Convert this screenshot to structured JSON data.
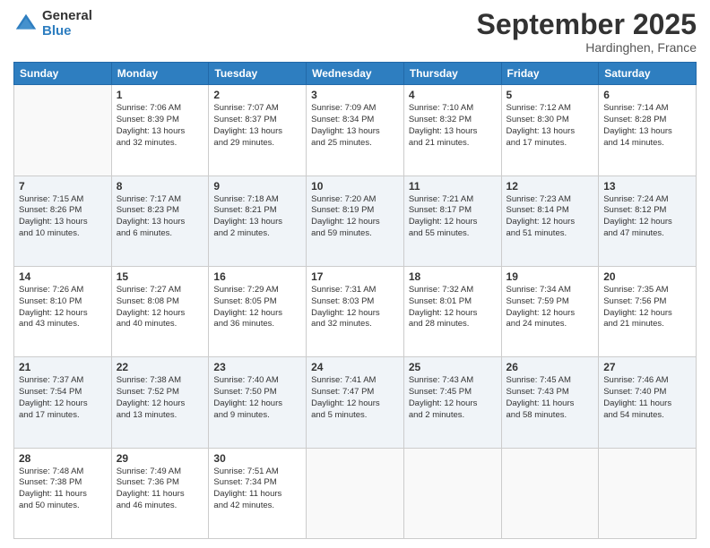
{
  "logo": {
    "general": "General",
    "blue": "Blue"
  },
  "title": "September 2025",
  "location": "Hardinghen, France",
  "days_header": [
    "Sunday",
    "Monday",
    "Tuesday",
    "Wednesday",
    "Thursday",
    "Friday",
    "Saturday"
  ],
  "weeks": [
    [
      {
        "day": "",
        "info": ""
      },
      {
        "day": "1",
        "info": "Sunrise: 7:06 AM\nSunset: 8:39 PM\nDaylight: 13 hours\nand 32 minutes."
      },
      {
        "day": "2",
        "info": "Sunrise: 7:07 AM\nSunset: 8:37 PM\nDaylight: 13 hours\nand 29 minutes."
      },
      {
        "day": "3",
        "info": "Sunrise: 7:09 AM\nSunset: 8:34 PM\nDaylight: 13 hours\nand 25 minutes."
      },
      {
        "day": "4",
        "info": "Sunrise: 7:10 AM\nSunset: 8:32 PM\nDaylight: 13 hours\nand 21 minutes."
      },
      {
        "day": "5",
        "info": "Sunrise: 7:12 AM\nSunset: 8:30 PM\nDaylight: 13 hours\nand 17 minutes."
      },
      {
        "day": "6",
        "info": "Sunrise: 7:14 AM\nSunset: 8:28 PM\nDaylight: 13 hours\nand 14 minutes."
      }
    ],
    [
      {
        "day": "7",
        "info": "Sunrise: 7:15 AM\nSunset: 8:26 PM\nDaylight: 13 hours\nand 10 minutes."
      },
      {
        "day": "8",
        "info": "Sunrise: 7:17 AM\nSunset: 8:23 PM\nDaylight: 13 hours\nand 6 minutes."
      },
      {
        "day": "9",
        "info": "Sunrise: 7:18 AM\nSunset: 8:21 PM\nDaylight: 13 hours\nand 2 minutes."
      },
      {
        "day": "10",
        "info": "Sunrise: 7:20 AM\nSunset: 8:19 PM\nDaylight: 12 hours\nand 59 minutes."
      },
      {
        "day": "11",
        "info": "Sunrise: 7:21 AM\nSunset: 8:17 PM\nDaylight: 12 hours\nand 55 minutes."
      },
      {
        "day": "12",
        "info": "Sunrise: 7:23 AM\nSunset: 8:14 PM\nDaylight: 12 hours\nand 51 minutes."
      },
      {
        "day": "13",
        "info": "Sunrise: 7:24 AM\nSunset: 8:12 PM\nDaylight: 12 hours\nand 47 minutes."
      }
    ],
    [
      {
        "day": "14",
        "info": "Sunrise: 7:26 AM\nSunset: 8:10 PM\nDaylight: 12 hours\nand 43 minutes."
      },
      {
        "day": "15",
        "info": "Sunrise: 7:27 AM\nSunset: 8:08 PM\nDaylight: 12 hours\nand 40 minutes."
      },
      {
        "day": "16",
        "info": "Sunrise: 7:29 AM\nSunset: 8:05 PM\nDaylight: 12 hours\nand 36 minutes."
      },
      {
        "day": "17",
        "info": "Sunrise: 7:31 AM\nSunset: 8:03 PM\nDaylight: 12 hours\nand 32 minutes."
      },
      {
        "day": "18",
        "info": "Sunrise: 7:32 AM\nSunset: 8:01 PM\nDaylight: 12 hours\nand 28 minutes."
      },
      {
        "day": "19",
        "info": "Sunrise: 7:34 AM\nSunset: 7:59 PM\nDaylight: 12 hours\nand 24 minutes."
      },
      {
        "day": "20",
        "info": "Sunrise: 7:35 AM\nSunset: 7:56 PM\nDaylight: 12 hours\nand 21 minutes."
      }
    ],
    [
      {
        "day": "21",
        "info": "Sunrise: 7:37 AM\nSunset: 7:54 PM\nDaylight: 12 hours\nand 17 minutes."
      },
      {
        "day": "22",
        "info": "Sunrise: 7:38 AM\nSunset: 7:52 PM\nDaylight: 12 hours\nand 13 minutes."
      },
      {
        "day": "23",
        "info": "Sunrise: 7:40 AM\nSunset: 7:50 PM\nDaylight: 12 hours\nand 9 minutes."
      },
      {
        "day": "24",
        "info": "Sunrise: 7:41 AM\nSunset: 7:47 PM\nDaylight: 12 hours\nand 5 minutes."
      },
      {
        "day": "25",
        "info": "Sunrise: 7:43 AM\nSunset: 7:45 PM\nDaylight: 12 hours\nand 2 minutes."
      },
      {
        "day": "26",
        "info": "Sunrise: 7:45 AM\nSunset: 7:43 PM\nDaylight: 11 hours\nand 58 minutes."
      },
      {
        "day": "27",
        "info": "Sunrise: 7:46 AM\nSunset: 7:40 PM\nDaylight: 11 hours\nand 54 minutes."
      }
    ],
    [
      {
        "day": "28",
        "info": "Sunrise: 7:48 AM\nSunset: 7:38 PM\nDaylight: 11 hours\nand 50 minutes."
      },
      {
        "day": "29",
        "info": "Sunrise: 7:49 AM\nSunset: 7:36 PM\nDaylight: 11 hours\nand 46 minutes."
      },
      {
        "day": "30",
        "info": "Sunrise: 7:51 AM\nSunset: 7:34 PM\nDaylight: 11 hours\nand 42 minutes."
      },
      {
        "day": "",
        "info": ""
      },
      {
        "day": "",
        "info": ""
      },
      {
        "day": "",
        "info": ""
      },
      {
        "day": "",
        "info": ""
      }
    ]
  ]
}
